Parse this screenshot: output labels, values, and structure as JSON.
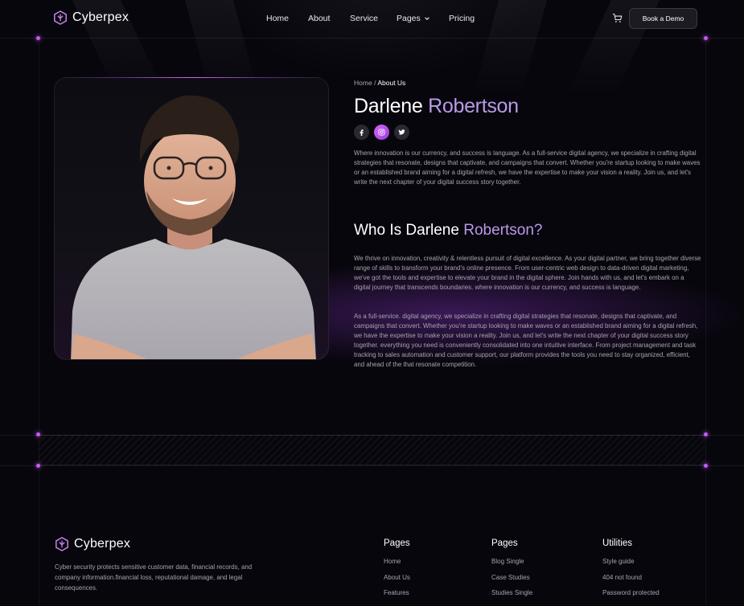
{
  "brand": {
    "name": "Cyberpex"
  },
  "nav": {
    "items": [
      "Home",
      "About",
      "Service",
      "Pages",
      "Pricing"
    ],
    "cta": "Book a Demo"
  },
  "breadcrumb": {
    "home": "Home",
    "separator": "/",
    "current": "About Us"
  },
  "profile": {
    "first_name": "Darlene",
    "last_name": "Robertson",
    "intro": "Where innovation is our currency, and success is language. As a full-service digital agency, we specialize in crafting digital strategies that resonate, designs that captivate, and campaigns that convert. Whether you're startup looking to make waves or an established brand aiming for a digital refresh, we have the expertise to make your vision a reality. Join us, and let's write the next chapter of your digital success story together.",
    "socials": [
      "facebook-icon",
      "instagram-icon",
      "twitter-icon"
    ]
  },
  "who": {
    "title_prefix": "Who Is Darlene",
    "title_highlight": "Robertson?",
    "para1": "We thrive on innovation, creativity & relentless pursuit of digital excellence. As your digital partner, we bring together diverse range of skills to transform your brand's online presence. From user-centric web design to data-driven digital marketing, we've got the tools and expertise to elevate your brand in the digital sphere. Join hands with us, and let's embark on a digital journey that transcends boundaries. where innovation is our currency, and success is language.",
    "para2": "As a full-service. digital agency, we specialize in crafting digital strategies that resonate, designs that captivate, and campaigns that convert. Whether you're startup looking to make waves or an established brand aiming for a digital refresh, we have the expertise to make your vision a reality. Join us, and let's write the next chapter of your digital success story together. everything you need is conveniently consolidated into one intuitive interface. From project management and task tracking to sales automation and customer support, our platform provides the tools you need to stay organized, efficient, and ahead of the that resonate competition."
  },
  "footer": {
    "description": "Cyber security protects sensitive customer data, financial records, and company information.financial loss, reputational damage, and legal consequences.",
    "columns": [
      {
        "title": "Pages",
        "links": [
          "Home",
          "About Us",
          "Features"
        ]
      },
      {
        "title": "Pages",
        "links": [
          "Blog Single",
          "Case Studies",
          "Studies Single"
        ]
      },
      {
        "title": "Utilities",
        "links": [
          "Style guide",
          "404 not found",
          "Password protected"
        ]
      }
    ]
  },
  "colors": {
    "accent": "#b89ae8",
    "glow": "#c25cf0",
    "background": "#08060d"
  }
}
